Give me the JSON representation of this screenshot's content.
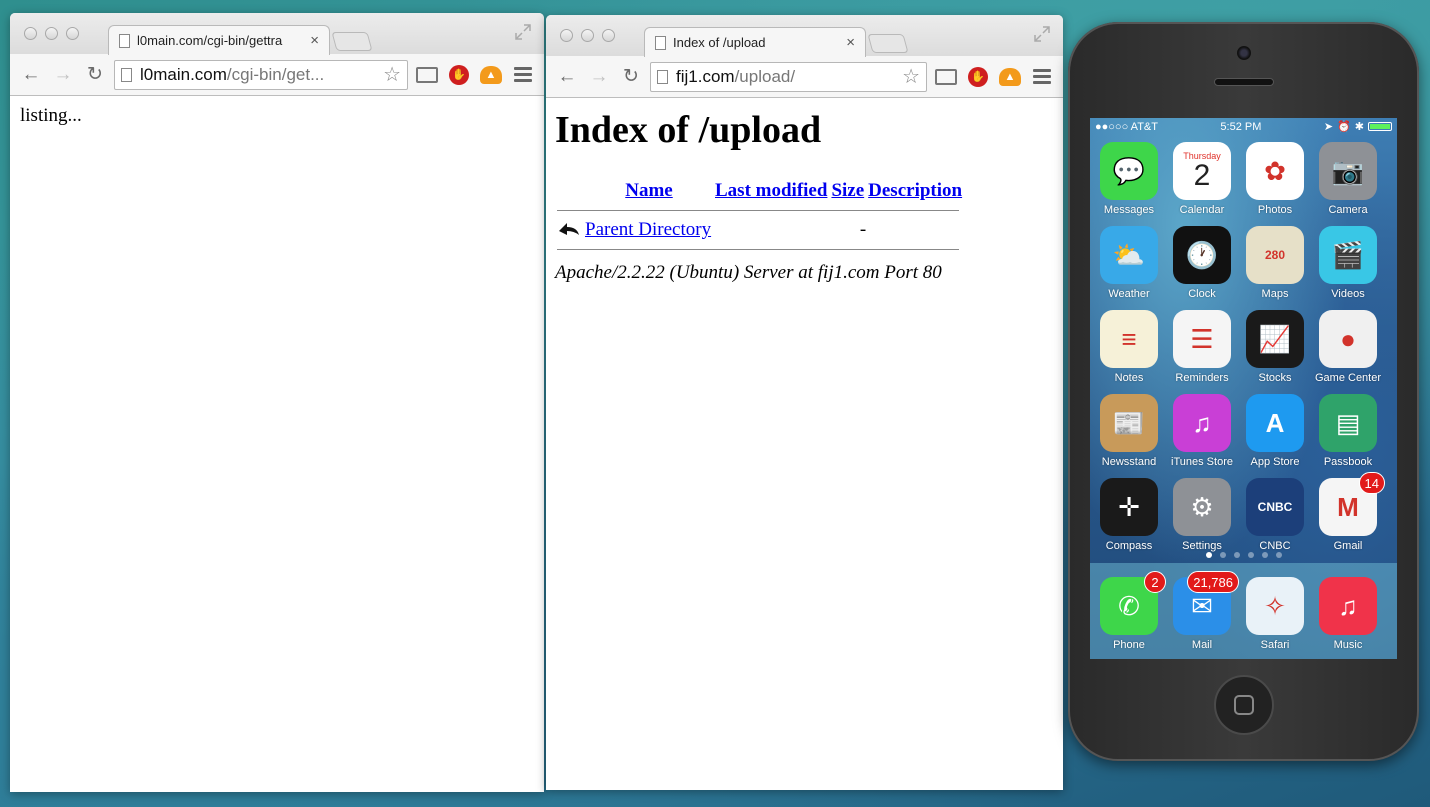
{
  "left_window": {
    "tab_title": "l0main.com/cgi-bin/gettra",
    "url_host": "l0main.com",
    "url_path": "/cgi-bin/get...",
    "body_text": "listing..."
  },
  "right_window": {
    "tab_title": "Index of /upload",
    "url_host": "fij1.com",
    "url_path": "/upload/",
    "heading": "Index of /upload",
    "columns": [
      "Name",
      "Last modified",
      "Size",
      "Description"
    ],
    "rows": [
      {
        "name": "Parent Directory",
        "modified": "",
        "size": "-",
        "description": ""
      }
    ],
    "address": "Apache/2.2.22 (Ubuntu) Server at fij1.com Port 80"
  },
  "toolbar_icons": [
    "back-icon",
    "forward-icon",
    "reload-icon",
    "star-icon",
    "cast-icon",
    "adblock-icon",
    "upload-extension-icon",
    "menu-icon"
  ],
  "phone": {
    "carrier": "●●○○○ AT&T",
    "time": "5:52 PM",
    "calendar_day": "Thursday",
    "calendar_date": "2",
    "apps": [
      {
        "label": "Messages",
        "color": "#3ed64a",
        "glyph": "💬"
      },
      {
        "label": "Calendar",
        "color": "#ffffff",
        "glyph": ""
      },
      {
        "label": "Photos",
        "color": "#ffffff",
        "glyph": "✿"
      },
      {
        "label": "Camera",
        "color": "#8e9196",
        "glyph": "📷"
      },
      {
        "label": "Weather",
        "color": "#38a9e8",
        "glyph": "⛅"
      },
      {
        "label": "Clock",
        "color": "#111111",
        "glyph": "🕐"
      },
      {
        "label": "Maps",
        "color": "#e6e0c8",
        "glyph": "280"
      },
      {
        "label": "Videos",
        "color": "#39c7e6",
        "glyph": "🎬"
      },
      {
        "label": "Notes",
        "color": "#f6f1d8",
        "glyph": "≡"
      },
      {
        "label": "Reminders",
        "color": "#f5f5f5",
        "glyph": "☰"
      },
      {
        "label": "Stocks",
        "color": "#1a1a1a",
        "glyph": "📈"
      },
      {
        "label": "Game Center",
        "color": "#f0f0f0",
        "glyph": "●"
      },
      {
        "label": "Newsstand",
        "color": "#c89a5a",
        "glyph": "📰"
      },
      {
        "label": "iTunes Store",
        "color": "#c93fd6",
        "glyph": "♫"
      },
      {
        "label": "App Store",
        "color": "#1e9af0",
        "glyph": "A"
      },
      {
        "label": "Passbook",
        "color": "#2fa36a",
        "glyph": "▤"
      },
      {
        "label": "Compass",
        "color": "#1a1a1a",
        "glyph": "✛"
      },
      {
        "label": "Settings",
        "color": "#8e9196",
        "glyph": "⚙"
      },
      {
        "label": "CNBC",
        "color": "#1c3f7a",
        "glyph": "CNBC"
      },
      {
        "label": "Gmail",
        "color": "#f5f5f5",
        "glyph": "M",
        "badge": "14"
      }
    ],
    "dock": [
      {
        "label": "Phone",
        "color": "#3ed64a",
        "glyph": "✆",
        "badge": "2"
      },
      {
        "label": "Mail",
        "color": "#2b8fe8",
        "glyph": "✉",
        "badge": "21,786"
      },
      {
        "label": "Safari",
        "color": "#e9f2f8",
        "glyph": "✧"
      },
      {
        "label": "Music",
        "color": "#f0334a",
        "glyph": "♫"
      }
    ]
  }
}
